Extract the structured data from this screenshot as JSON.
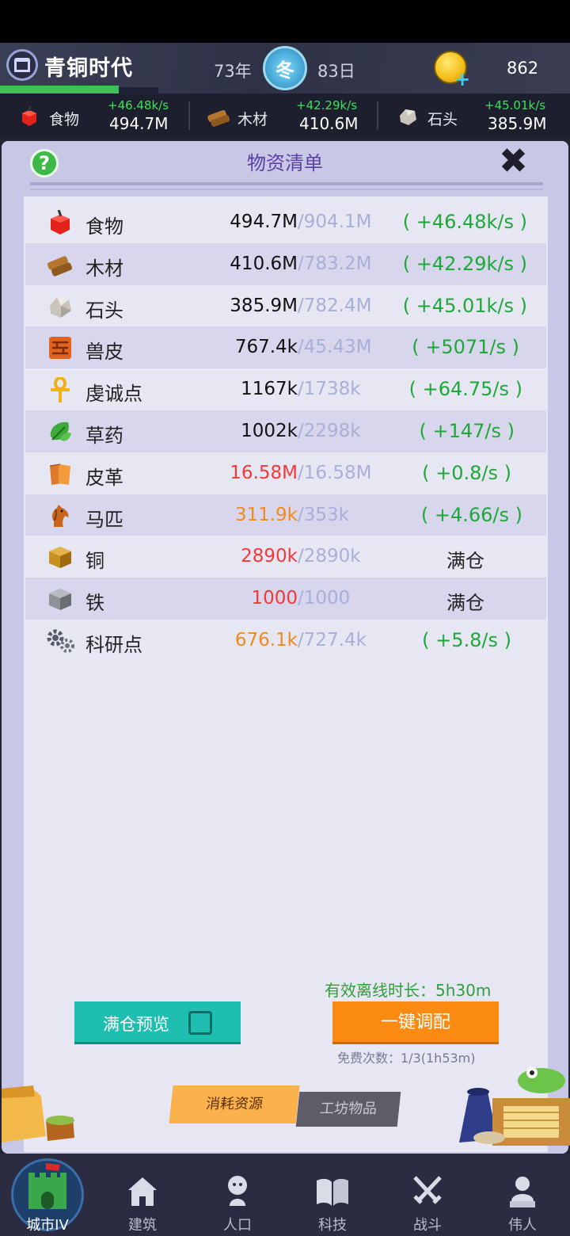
{
  "header": {
    "era": "青铜时代",
    "year": "73年",
    "season": "冬",
    "day": "83日",
    "gold": "862"
  },
  "resbar": [
    {
      "name": "食物",
      "rate": "+46.48k/s",
      "value": "494.7M",
      "icon": "apple-icon"
    },
    {
      "name": "木材",
      "rate": "+42.29k/s",
      "value": "410.6M",
      "icon": "wood-icon"
    },
    {
      "name": "石头",
      "rate": "+45.01k/s",
      "value": "385.9M",
      "icon": "stone-icon"
    }
  ],
  "panel": {
    "title": "物资清单",
    "help": "?",
    "close": "✖",
    "offline": "有效离线时长：5h30m",
    "preview_label": "满仓预览",
    "alloc_label": "一键调配",
    "free_times": "免费次数：1/3(1h53m)",
    "tab_consume": "消耗资源",
    "tab_workshop": "工坊物品"
  },
  "resources": [
    {
      "name": "食物",
      "amount": "494.7M",
      "cap": "/904.1M",
      "rate": "( +46.48k/s )",
      "amount_color": "#111111",
      "icon": "apple-icon"
    },
    {
      "name": "木材",
      "amount": "410.6M",
      "cap": "/783.2M",
      "rate": "( +42.29k/s )",
      "amount_color": "#111111",
      "icon": "wood-icon"
    },
    {
      "name": "石头",
      "amount": "385.9M",
      "cap": "/782.4M",
      "rate": "( +45.01k/s )",
      "amount_color": "#111111",
      "icon": "stone-icon"
    },
    {
      "name": "兽皮",
      "amount": "767.4k",
      "cap": "/45.43M",
      "rate": "( +5071/s )",
      "amount_color": "#111111",
      "icon": "hide-icon"
    },
    {
      "name": "虔诚点",
      "amount": "1167k",
      "cap": "/1738k",
      "rate": "( +64.75/s )",
      "amount_color": "#111111",
      "icon": "ankh-icon"
    },
    {
      "name": "草药",
      "amount": "1002k",
      "cap": "/2298k",
      "rate": "( +147/s )",
      "amount_color": "#111111",
      "icon": "herb-icon"
    },
    {
      "name": "皮革",
      "amount": "16.58M",
      "cap": "/16.58M",
      "rate": "( +0.8/s )",
      "amount_color": "#f03a3a",
      "icon": "leather-icon"
    },
    {
      "name": "马匹",
      "amount": "311.9k",
      "cap": "/353k",
      "rate": "( +4.66/s )",
      "amount_color": "#f08a1c",
      "icon": "horse-icon"
    },
    {
      "name": "铜",
      "amount": "2890k",
      "cap": "/2890k",
      "full": "满仓",
      "amount_color": "#f03a3a",
      "icon": "copper-icon"
    },
    {
      "name": "铁",
      "amount": "1000",
      "cap": "/1000",
      "full": "满仓",
      "amount_color": "#f03a3a",
      "icon": "iron-icon"
    },
    {
      "name": "科研点",
      "amount": "676.1k",
      "cap": "/727.4k",
      "rate": "( +5.8/s )",
      "amount_color": "#f08a1c",
      "icon": "gears-icon"
    }
  ],
  "nav": [
    {
      "label": "城市IV",
      "icon": "castle-icon",
      "active": true
    },
    {
      "label": "建筑",
      "icon": "house-icon"
    },
    {
      "label": "人口",
      "icon": "person-icon"
    },
    {
      "label": "科技",
      "icon": "book-icon"
    },
    {
      "label": "战斗",
      "icon": "swords-icon"
    },
    {
      "label": "伟人",
      "icon": "bust-icon"
    }
  ]
}
